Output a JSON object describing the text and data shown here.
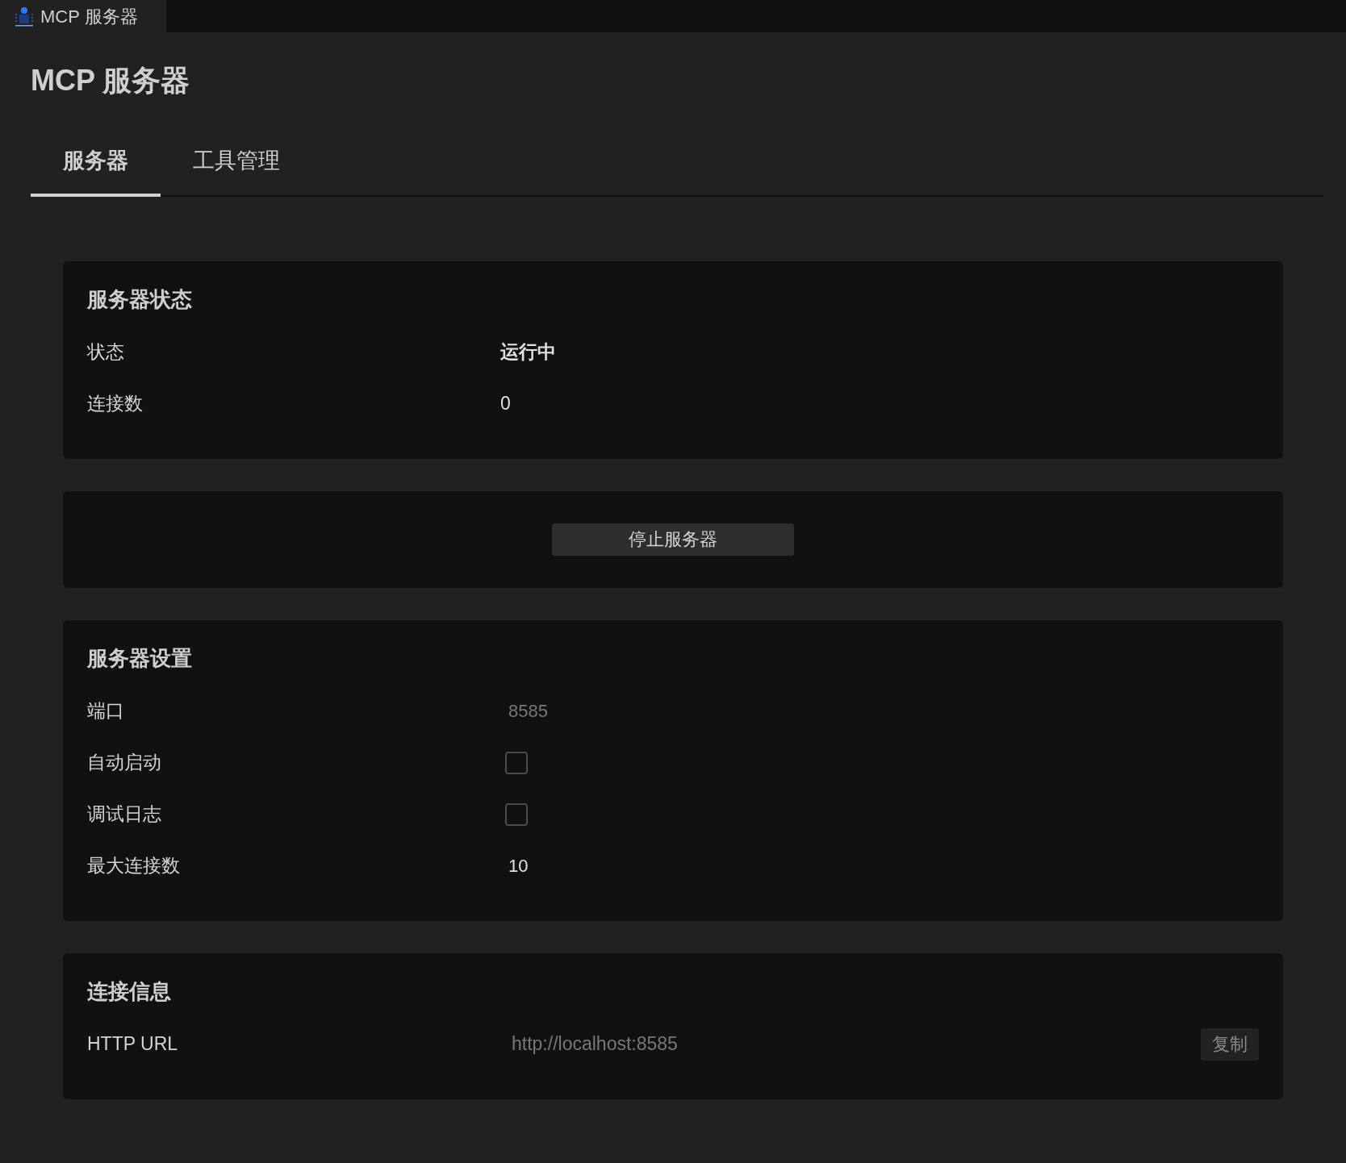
{
  "window": {
    "title": "MCP 服务器"
  },
  "heading": "MCP 服务器",
  "tabs": [
    {
      "label": "服务器",
      "selected": true
    },
    {
      "label": "工具管理",
      "selected": false
    }
  ],
  "cards": [
    {
      "title": "服务器状态",
      "rows": [
        {
          "kind": "text",
          "label": "状态",
          "value": "运行中",
          "bold": true
        },
        {
          "kind": "text",
          "label": "连接数",
          "value": "0",
          "bold": false
        }
      ]
    },
    {
      "button": "停止服务器"
    },
    {
      "title": "服务器设置",
      "rows": [
        {
          "kind": "field",
          "label": "端口",
          "placeholder": "8585"
        },
        {
          "kind": "checkbox",
          "label": "自动启动",
          "checked": false
        },
        {
          "kind": "checkbox",
          "label": "调试日志",
          "checked": false
        },
        {
          "kind": "field",
          "label": "最大连接数",
          "value": "10"
        }
      ]
    },
    {
      "title": "连接信息",
      "rows": [
        {
          "kind": "url",
          "label": "HTTP URL",
          "placeholder": "http://localhost:8585",
          "button": "复制"
        }
      ]
    }
  ]
}
